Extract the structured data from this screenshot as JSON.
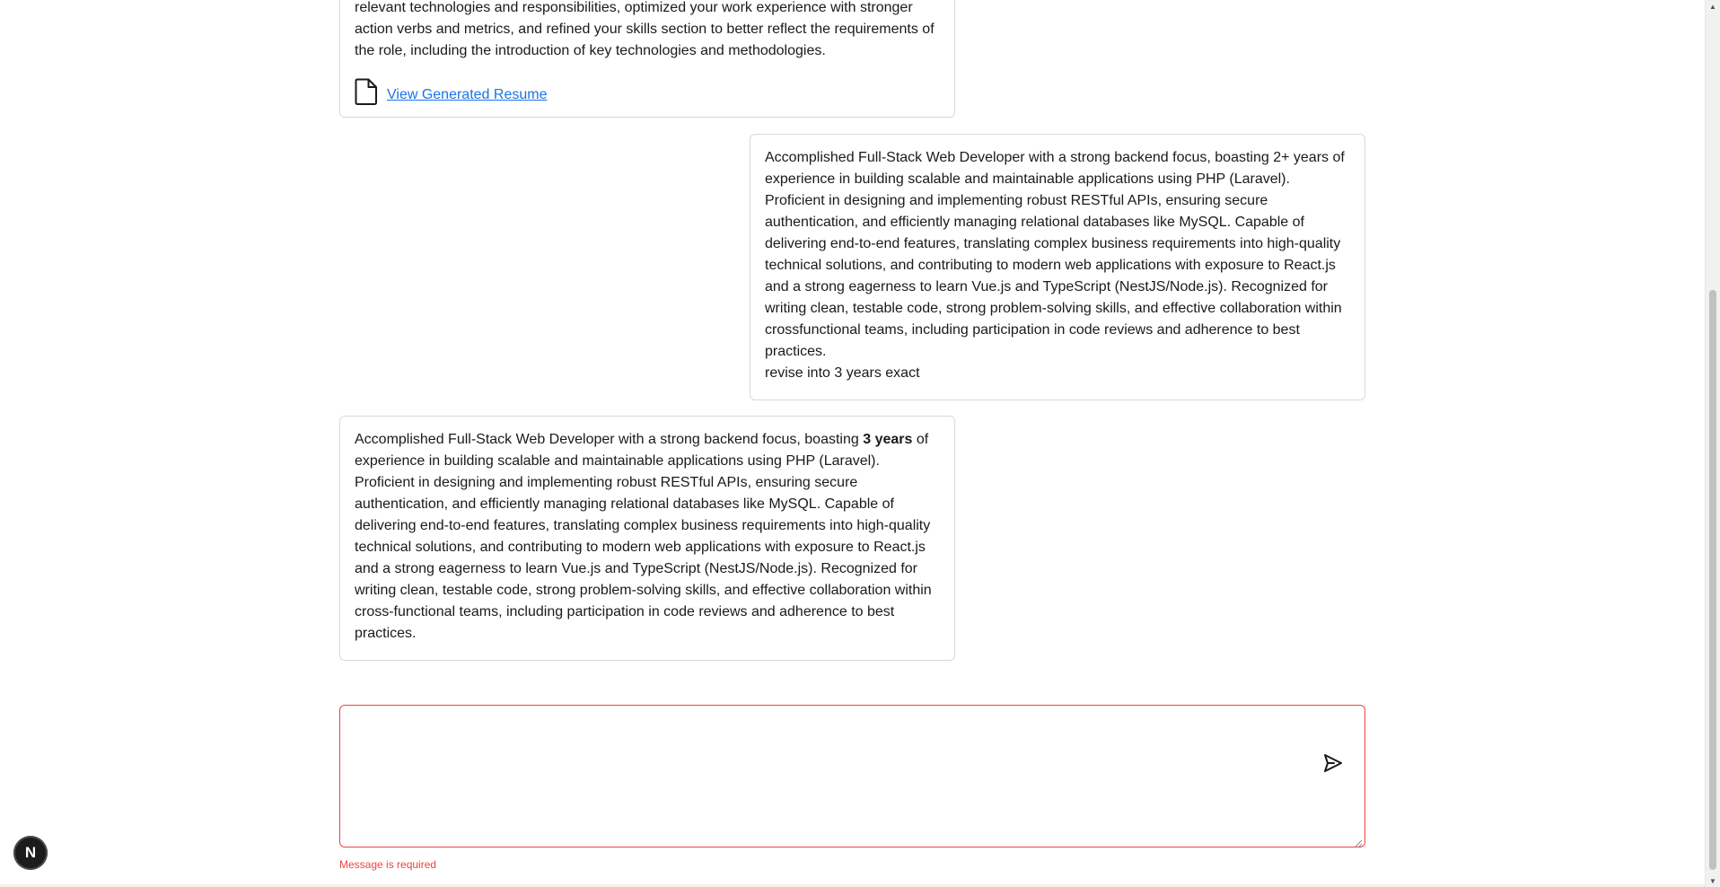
{
  "messages": [
    {
      "role": "assistant",
      "lines": [
        "relevant technologies and responsibilities, optimized your work experience with stronger",
        "action verbs and metrics, and refined your skills section to better reflect the requirements of",
        "the role, including the introduction of key technologies and methodologies."
      ],
      "link_label": "View Generated Resume"
    },
    {
      "role": "user",
      "text": "Accomplished Full-Stack Web Developer with a strong backend focus, boasting 2+ years of experience in building scalable and maintainable applications using PHP (Laravel). Proficient in designing and implementing robust RESTful APIs, ensuring secure authentication, and efficiently managing relational databases like MySQL. Capable of delivering end-to-end features, translating complex business requirements into high-quality technical solutions, and contributing to modern web applications with exposure to React.js and a strong eagerness to learn Vue.js and TypeScript (NestJS/Node.js). Recognized for writing clean, testable code, strong problem-solving skills, and effective collaboration within crossfunctional teams, including participation in code reviews and adherence to best practices.",
      "instruction": "revise into 3 years exact"
    },
    {
      "role": "assistant",
      "text_before": "Accomplished Full-Stack Web Developer with a strong backend focus, boasting ",
      "text_bold": "3 years",
      "text_after": " of experience in building scalable and maintainable applications using PHP (Laravel). Proficient in designing and implementing robust RESTful APIs, ensuring secure authentication, and efficiently managing relational databases like MySQL. Capable of delivering end-to-end features, translating complex business requirements into high-quality technical solutions, and contributing to modern web applications with exposure to React.js and a strong eagerness to learn Vue.js and TypeScript (NestJS/Node.js). Recognized for writing clean, testable code, strong problem-solving skills, and effective collaboration within cross-functional teams, including participation in code reviews and adherence to best practices."
    }
  ],
  "composer": {
    "value": "",
    "placeholder": "",
    "error": "Message is required"
  },
  "badge": {
    "letter": "N"
  },
  "icons": {
    "file": "file-icon",
    "send": "send-icon"
  },
  "colors": {
    "error": "#ef4444",
    "link": "#1a73e8",
    "border": "#d9d9d9"
  }
}
